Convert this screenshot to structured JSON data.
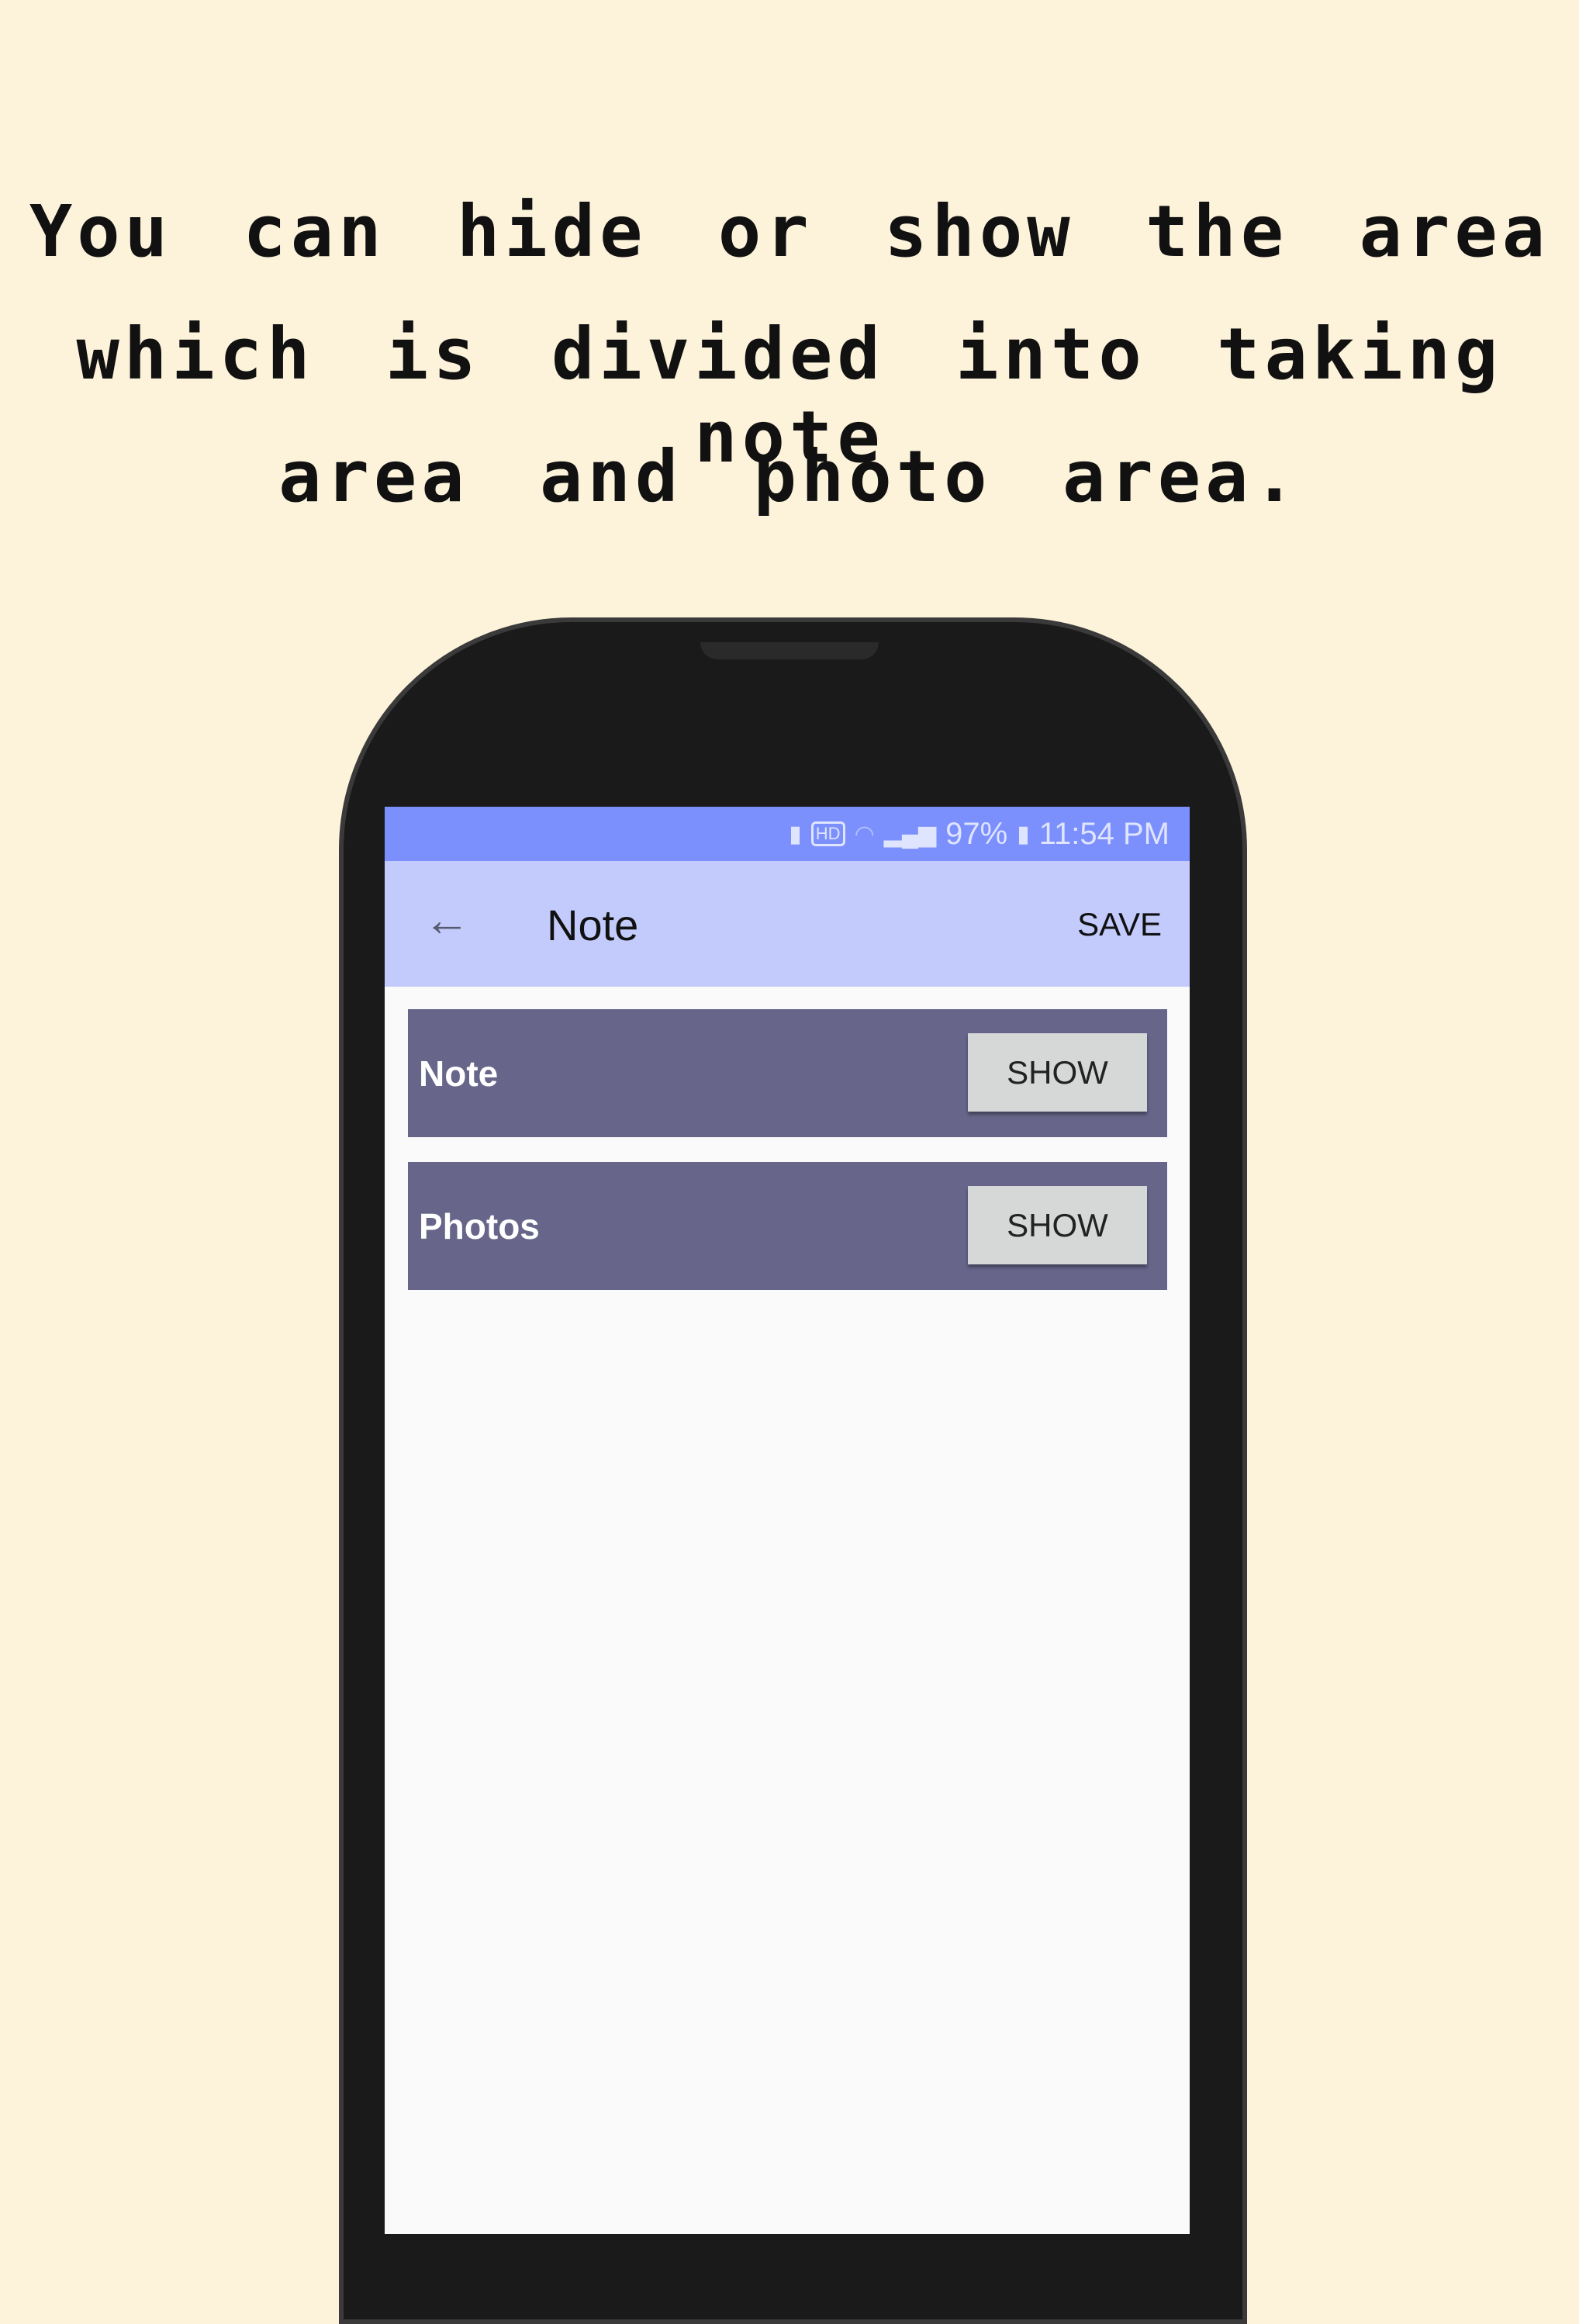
{
  "headline": {
    "lines": [
      "You can hide or show the area",
      "which is divided into taking note",
      "area and photo area."
    ]
  },
  "status_bar": {
    "icons": [
      "battery-saver-icon",
      "hd-voice-icon",
      "wifi-icon",
      "signal-icon",
      "battery-icon"
    ],
    "hd_label": "HD",
    "battery_percent": "97%",
    "time": "11:54 PM",
    "color": "#7b8ffd"
  },
  "app_bar": {
    "back_icon": "arrow-left-icon",
    "title": "Note",
    "save_label": "SAVE",
    "color": "#c3cbfc"
  },
  "sections": [
    {
      "label": "Note",
      "button": "SHOW"
    },
    {
      "label": "Photos",
      "button": "SHOW"
    }
  ],
  "colors": {
    "background": "#fdf3db",
    "section": "#67668a",
    "button": "#d6d7d7"
  }
}
